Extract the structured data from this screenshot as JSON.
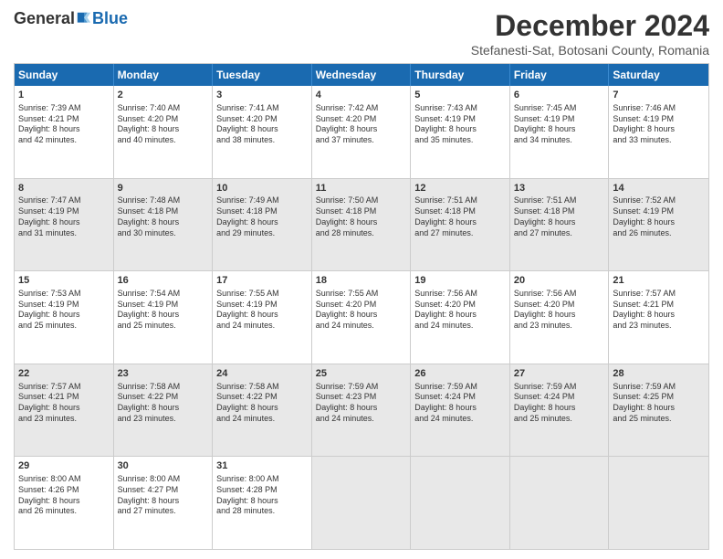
{
  "header": {
    "logo": {
      "general": "General",
      "blue": "Blue",
      "tagline": ""
    },
    "title": "December 2024",
    "subtitle": "Stefanesti-Sat, Botosani County, Romania"
  },
  "weekdays": [
    "Sunday",
    "Monday",
    "Tuesday",
    "Wednesday",
    "Thursday",
    "Friday",
    "Saturday"
  ],
  "weeks": [
    [
      {
        "day": "1",
        "info": "Sunrise: 7:39 AM\nSunset: 4:21 PM\nDaylight: 8 hours\nand 42 minutes."
      },
      {
        "day": "2",
        "info": "Sunrise: 7:40 AM\nSunset: 4:20 PM\nDaylight: 8 hours\nand 40 minutes."
      },
      {
        "day": "3",
        "info": "Sunrise: 7:41 AM\nSunset: 4:20 PM\nDaylight: 8 hours\nand 38 minutes."
      },
      {
        "day": "4",
        "info": "Sunrise: 7:42 AM\nSunset: 4:20 PM\nDaylight: 8 hours\nand 37 minutes."
      },
      {
        "day": "5",
        "info": "Sunrise: 7:43 AM\nSunset: 4:19 PM\nDaylight: 8 hours\nand 35 minutes."
      },
      {
        "day": "6",
        "info": "Sunrise: 7:45 AM\nSunset: 4:19 PM\nDaylight: 8 hours\nand 34 minutes."
      },
      {
        "day": "7",
        "info": "Sunrise: 7:46 AM\nSunset: 4:19 PM\nDaylight: 8 hours\nand 33 minutes."
      }
    ],
    [
      {
        "day": "8",
        "info": "Sunrise: 7:47 AM\nSunset: 4:19 PM\nDaylight: 8 hours\nand 31 minutes."
      },
      {
        "day": "9",
        "info": "Sunrise: 7:48 AM\nSunset: 4:18 PM\nDaylight: 8 hours\nand 30 minutes."
      },
      {
        "day": "10",
        "info": "Sunrise: 7:49 AM\nSunset: 4:18 PM\nDaylight: 8 hours\nand 29 minutes."
      },
      {
        "day": "11",
        "info": "Sunrise: 7:50 AM\nSunset: 4:18 PM\nDaylight: 8 hours\nand 28 minutes."
      },
      {
        "day": "12",
        "info": "Sunrise: 7:51 AM\nSunset: 4:18 PM\nDaylight: 8 hours\nand 27 minutes."
      },
      {
        "day": "13",
        "info": "Sunrise: 7:51 AM\nSunset: 4:18 PM\nDaylight: 8 hours\nand 27 minutes."
      },
      {
        "day": "14",
        "info": "Sunrise: 7:52 AM\nSunset: 4:19 PM\nDaylight: 8 hours\nand 26 minutes."
      }
    ],
    [
      {
        "day": "15",
        "info": "Sunrise: 7:53 AM\nSunset: 4:19 PM\nDaylight: 8 hours\nand 25 minutes."
      },
      {
        "day": "16",
        "info": "Sunrise: 7:54 AM\nSunset: 4:19 PM\nDaylight: 8 hours\nand 25 minutes."
      },
      {
        "day": "17",
        "info": "Sunrise: 7:55 AM\nSunset: 4:19 PM\nDaylight: 8 hours\nand 24 minutes."
      },
      {
        "day": "18",
        "info": "Sunrise: 7:55 AM\nSunset: 4:20 PM\nDaylight: 8 hours\nand 24 minutes."
      },
      {
        "day": "19",
        "info": "Sunrise: 7:56 AM\nSunset: 4:20 PM\nDaylight: 8 hours\nand 24 minutes."
      },
      {
        "day": "20",
        "info": "Sunrise: 7:56 AM\nSunset: 4:20 PM\nDaylight: 8 hours\nand 23 minutes."
      },
      {
        "day": "21",
        "info": "Sunrise: 7:57 AM\nSunset: 4:21 PM\nDaylight: 8 hours\nand 23 minutes."
      }
    ],
    [
      {
        "day": "22",
        "info": "Sunrise: 7:57 AM\nSunset: 4:21 PM\nDaylight: 8 hours\nand 23 minutes."
      },
      {
        "day": "23",
        "info": "Sunrise: 7:58 AM\nSunset: 4:22 PM\nDaylight: 8 hours\nand 23 minutes."
      },
      {
        "day": "24",
        "info": "Sunrise: 7:58 AM\nSunset: 4:22 PM\nDaylight: 8 hours\nand 24 minutes."
      },
      {
        "day": "25",
        "info": "Sunrise: 7:59 AM\nSunset: 4:23 PM\nDaylight: 8 hours\nand 24 minutes."
      },
      {
        "day": "26",
        "info": "Sunrise: 7:59 AM\nSunset: 4:24 PM\nDaylight: 8 hours\nand 24 minutes."
      },
      {
        "day": "27",
        "info": "Sunrise: 7:59 AM\nSunset: 4:24 PM\nDaylight: 8 hours\nand 25 minutes."
      },
      {
        "day": "28",
        "info": "Sunrise: 7:59 AM\nSunset: 4:25 PM\nDaylight: 8 hours\nand 25 minutes."
      }
    ],
    [
      {
        "day": "29",
        "info": "Sunrise: 8:00 AM\nSunset: 4:26 PM\nDaylight: 8 hours\nand 26 minutes."
      },
      {
        "day": "30",
        "info": "Sunrise: 8:00 AM\nSunset: 4:27 PM\nDaylight: 8 hours\nand 27 minutes."
      },
      {
        "day": "31",
        "info": "Sunrise: 8:00 AM\nSunset: 4:28 PM\nDaylight: 8 hours\nand 28 minutes."
      },
      {
        "day": "",
        "info": ""
      },
      {
        "day": "",
        "info": ""
      },
      {
        "day": "",
        "info": ""
      },
      {
        "day": "",
        "info": ""
      }
    ]
  ]
}
